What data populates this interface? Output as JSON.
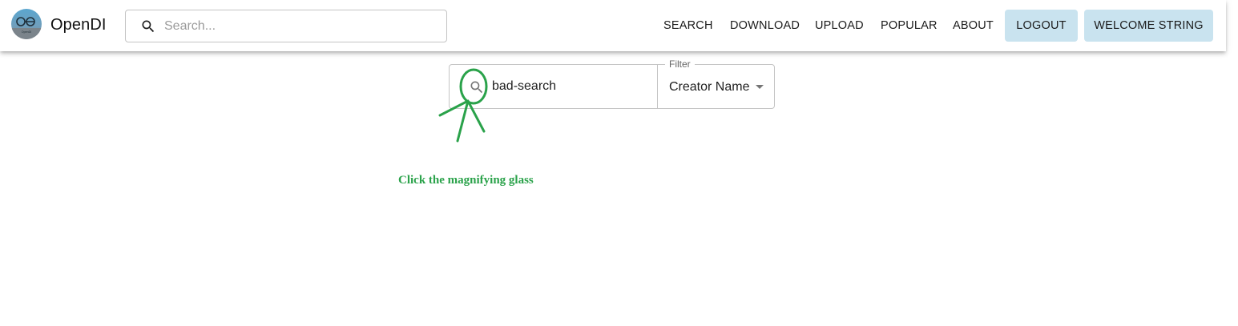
{
  "app": {
    "name": "OpenDI",
    "logo_text": "OpenDI"
  },
  "header": {
    "search": {
      "placeholder": "Search...",
      "value": ""
    },
    "nav": [
      {
        "label": "SEARCH"
      },
      {
        "label": "DOWNLOAD"
      },
      {
        "label": "UPLOAD"
      },
      {
        "label": "POPULAR"
      },
      {
        "label": "ABOUT"
      }
    ],
    "buttons": [
      {
        "label": "LOGOUT"
      },
      {
        "label": "WELCOME STRING"
      }
    ]
  },
  "search_panel": {
    "query": "bad-search",
    "filter": {
      "label": "Filter",
      "value": "Creator Name"
    }
  },
  "annotation": {
    "text": "Click the magnifying glass",
    "color": "#2aa24a"
  },
  "colors": {
    "button_bg": "#c9e3ef",
    "border": "#c4c4c4"
  },
  "icons": {
    "header_search": "search-icon",
    "main_search": "search-icon",
    "filter_caret": "caret-down-icon"
  }
}
